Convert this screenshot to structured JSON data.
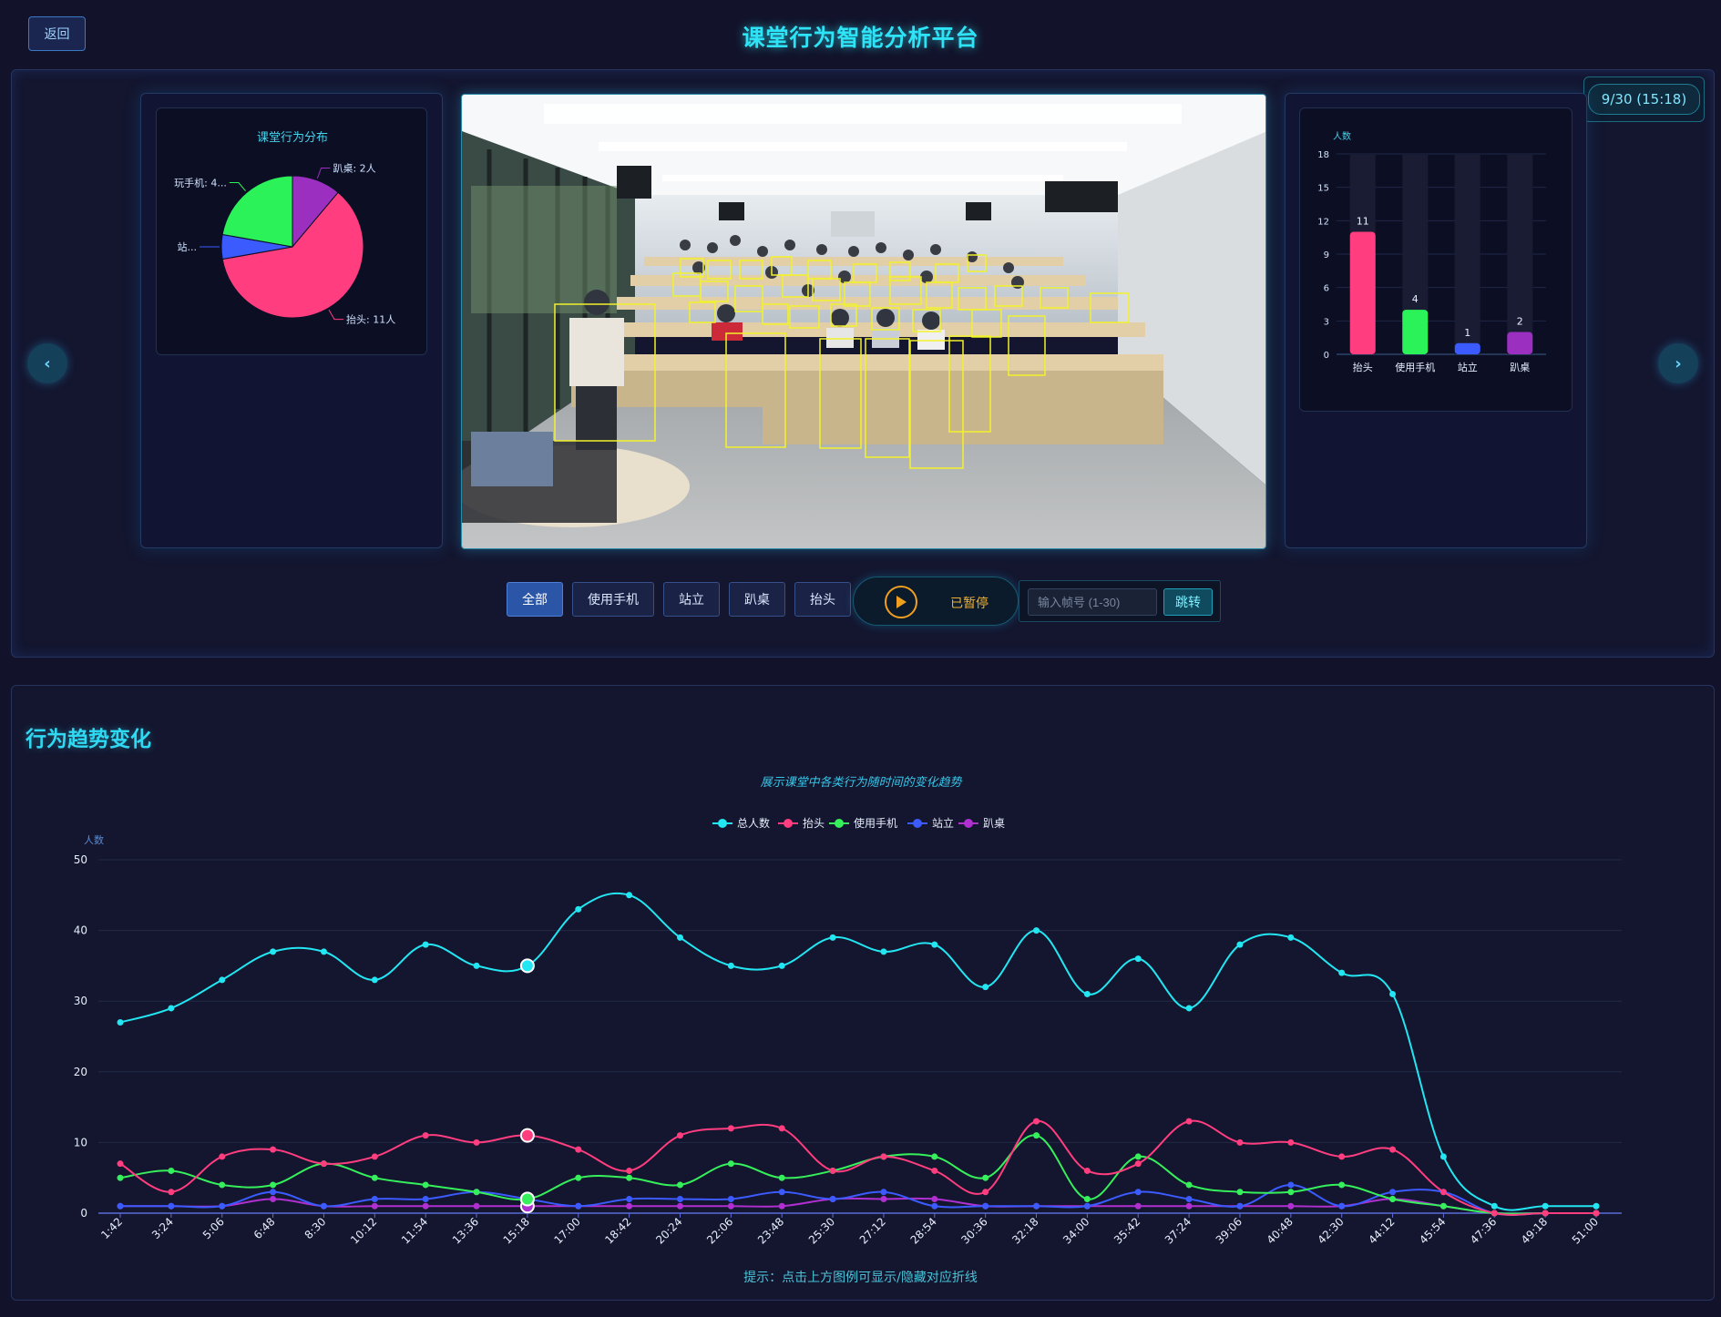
{
  "header": {
    "back_label": "返回",
    "title": "课堂行为智能分析平台"
  },
  "frame_badge": "9/30 (15:18)",
  "nav": {
    "prev_icon": "‹",
    "next_icon": "›"
  },
  "pie": {
    "title": "课堂行为分布",
    "slices": [
      {
        "name": "抬头",
        "value": 11,
        "color": "#ff3d7f",
        "label": "抬头: 11人"
      },
      {
        "name": "站立",
        "value": 1,
        "color": "#3b5bff",
        "label": "站..."
      },
      {
        "name": "使用手机",
        "value": 4,
        "color": "#2cf25a",
        "label": "玩手机: 4..."
      },
      {
        "name": "趴桌",
        "value": 2,
        "color": "#9b2fbf",
        "label": "趴桌: 2人"
      }
    ]
  },
  "bar": {
    "ylabel": "人数",
    "ylim": [
      0,
      18
    ],
    "yticks": [
      "0",
      "3",
      "6",
      "9",
      "12",
      "15",
      "18"
    ],
    "categories": [
      "抬头",
      "使用手机",
      "站立",
      "趴桌"
    ],
    "values": [
      11,
      4,
      1,
      2
    ],
    "value_labels": [
      "11",
      "4",
      "1",
      "2"
    ],
    "colors": [
      "#ff3d7f",
      "#2cf25a",
      "#3b5bff",
      "#9b2fbf"
    ]
  },
  "controls": {
    "filters": [
      {
        "label": "全部",
        "active": true
      },
      {
        "label": "使用手机",
        "active": false
      },
      {
        "label": "站立",
        "active": false
      },
      {
        "label": "趴桌",
        "active": false
      },
      {
        "label": "抬头",
        "active": false
      }
    ],
    "play_status": "已暂停",
    "frame_placeholder": "输入帧号 (1-30)",
    "jump_label": "跳转"
  },
  "trend": {
    "section_title": "行为趋势变化",
    "subtitle": "展示课堂中各类行为随时间的变化趋势",
    "hint": "提示：点击上方图例可显示/隐藏对应折线"
  },
  "chart_data": {
    "type": "line",
    "title": "",
    "subtitle": "展示课堂中各类行为随时间的变化趋势",
    "ylabel": "人数",
    "xlabel": "",
    "ylim": [
      0,
      50
    ],
    "yticks": [
      "0",
      "10",
      "20",
      "30",
      "40",
      "50"
    ],
    "grid": true,
    "legend_position": "top-center",
    "highlight_index": 8,
    "categories": [
      "1:42",
      "3:24",
      "5:06",
      "6:48",
      "8:30",
      "10:12",
      "11:54",
      "13:36",
      "15:18",
      "17:00",
      "18:42",
      "20:24",
      "22:06",
      "23:48",
      "25:30",
      "27:12",
      "28:54",
      "30:36",
      "32:18",
      "34:00",
      "35:42",
      "37:24",
      "39:06",
      "40:48",
      "42:30",
      "44:12",
      "45:54",
      "47:36",
      "49:18",
      "51:00"
    ],
    "series": [
      {
        "name": "总人数",
        "color": "#22e6f2",
        "values": [
          27,
          29,
          33,
          37,
          37,
          33,
          38,
          35,
          35,
          43,
          45,
          39,
          35,
          35,
          39,
          37,
          38,
          32,
          40,
          31,
          36,
          29,
          38,
          39,
          34,
          31,
          8,
          1,
          1,
          1
        ]
      },
      {
        "name": "抬头",
        "color": "#ff3d7f",
        "values": [
          7,
          3,
          8,
          9,
          7,
          8,
          11,
          10,
          11,
          9,
          6,
          11,
          12,
          12,
          6,
          8,
          6,
          3,
          13,
          6,
          7,
          13,
          10,
          10,
          8,
          9,
          3,
          0,
          0,
          0
        ]
      },
      {
        "name": "使用手机",
        "color": "#35f05a",
        "values": [
          5,
          6,
          4,
          4,
          7,
          5,
          4,
          3,
          2,
          5,
          5,
          4,
          7,
          5,
          6,
          8,
          8,
          5,
          11,
          2,
          8,
          4,
          3,
          3,
          4,
          2,
          1,
          0,
          0,
          0
        ]
      },
      {
        "name": "站立",
        "color": "#3b5bff",
        "values": [
          1,
          1,
          1,
          3,
          1,
          2,
          2,
          3,
          2,
          1,
          2,
          2,
          2,
          3,
          2,
          3,
          1,
          1,
          1,
          1,
          3,
          2,
          1,
          4,
          1,
          3,
          3,
          0,
          0,
          0
        ]
      },
      {
        "name": "趴桌",
        "color": "#b02fd0",
        "values": [
          1,
          1,
          1,
          2,
          1,
          1,
          1,
          1,
          1,
          1,
          1,
          1,
          1,
          1,
          2,
          2,
          2,
          1,
          1,
          1,
          1,
          1,
          1,
          1,
          1,
          2,
          1,
          0,
          0,
          0
        ]
      }
    ]
  }
}
